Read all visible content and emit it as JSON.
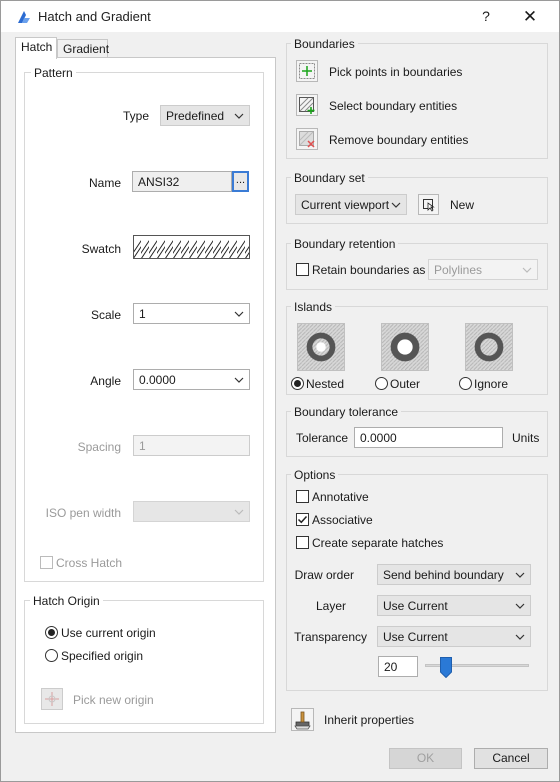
{
  "window": {
    "title": "Hatch and Gradient",
    "help": "?",
    "close": "✕"
  },
  "tabs": [
    "Hatch",
    "Gradient"
  ],
  "pattern": {
    "title": "Pattern",
    "type_label": "Type",
    "type_value": "Predefined",
    "name_label": "Name",
    "name_value": "ANSI32",
    "browse": "...",
    "swatch_label": "Swatch",
    "scale_label": "Scale",
    "scale_value": "1",
    "angle_label": "Angle",
    "angle_value": "0.0000",
    "spacing_label": "Spacing",
    "spacing_value": "1",
    "iso_label": "ISO pen width",
    "iso_value": "",
    "cross_hatch": "Cross Hatch"
  },
  "origin": {
    "title": "Hatch Origin",
    "use_current": "Use current origin",
    "specified": "Specified origin",
    "pick_new": "Pick new origin"
  },
  "boundaries": {
    "title": "Boundaries",
    "pick_points": "Pick points in boundaries",
    "select_entities": "Select boundary entities",
    "remove_entities": "Remove boundary entities"
  },
  "boundary_set": {
    "title": "Boundary set",
    "value": "Current viewport",
    "new_label": "New"
  },
  "retention": {
    "title": "Boundary retention",
    "retain_label": "Retain boundaries as",
    "retain_value": "Polylines"
  },
  "islands": {
    "title": "Islands",
    "nested": "Nested",
    "outer": "Outer",
    "ignore": "Ignore"
  },
  "tolerance": {
    "title": "Boundary tolerance",
    "label": "Tolerance",
    "value": "0.0000",
    "units": "Units"
  },
  "options": {
    "title": "Options",
    "annotative": "Annotative",
    "associative": "Associative",
    "separate": "Create separate hatches",
    "draw_order_label": "Draw order",
    "draw_order_value": "Send behind boundary",
    "layer_label": "Layer",
    "layer_value": "Use Current",
    "transparency_label": "Transparency",
    "transparency_value": "Use Current",
    "transparency_amount": "20",
    "transparency_level": 0.2
  },
  "inherit": "Inherit properties",
  "buttons": {
    "ok": "OK",
    "cancel": "Cancel"
  }
}
